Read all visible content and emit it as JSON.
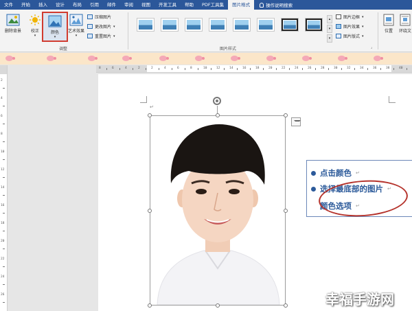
{
  "tabs": [
    {
      "label": "文件"
    },
    {
      "label": "开始"
    },
    {
      "label": "插入"
    },
    {
      "label": "设计"
    },
    {
      "label": "布局"
    },
    {
      "label": "引用"
    },
    {
      "label": "邮件"
    },
    {
      "label": "审阅"
    },
    {
      "label": "视图"
    },
    {
      "label": "开发工具"
    },
    {
      "label": "帮助"
    },
    {
      "label": "PDF工具集"
    },
    {
      "label": "图片格式",
      "active": true
    }
  ],
  "tell_me": "操作说明搜索",
  "ribbon": {
    "remove_bg": "删除背景",
    "corrections": "校正",
    "color": "颜色",
    "artistic": "艺术效果",
    "compress": "压缩图片",
    "change": "更改图片",
    "reset": "重置图片",
    "adjust_group": "调整",
    "styles_group": "图片样式",
    "border": "图片边框",
    "effects": "图片效果",
    "layout": "图片版式",
    "position": "位置",
    "wrap": "环绕文"
  },
  "ruler": {
    "h_numbers": [
      "8",
      "6",
      "4",
      "2",
      "2",
      "4",
      "6",
      "8",
      "10",
      "12",
      "14",
      "16",
      "18",
      "20",
      "22",
      "24",
      "26",
      "28",
      "30",
      "32",
      "34",
      "36",
      "38",
      "40"
    ],
    "v_numbers": [
      "2",
      "4",
      "6",
      "8",
      "10",
      "12",
      "14",
      "16",
      "18",
      "20",
      "22",
      "24",
      "26"
    ]
  },
  "callout": {
    "items": [
      "点击颜色",
      "选择最底部的图片",
      "颜色选项"
    ]
  },
  "watermark": "幸福手游网",
  "colors": {
    "tab_bar": "#2b579a",
    "callout_text": "#2c5a9a",
    "highlight_red": "#d13b2f",
    "strip": "#fbe6c9"
  }
}
